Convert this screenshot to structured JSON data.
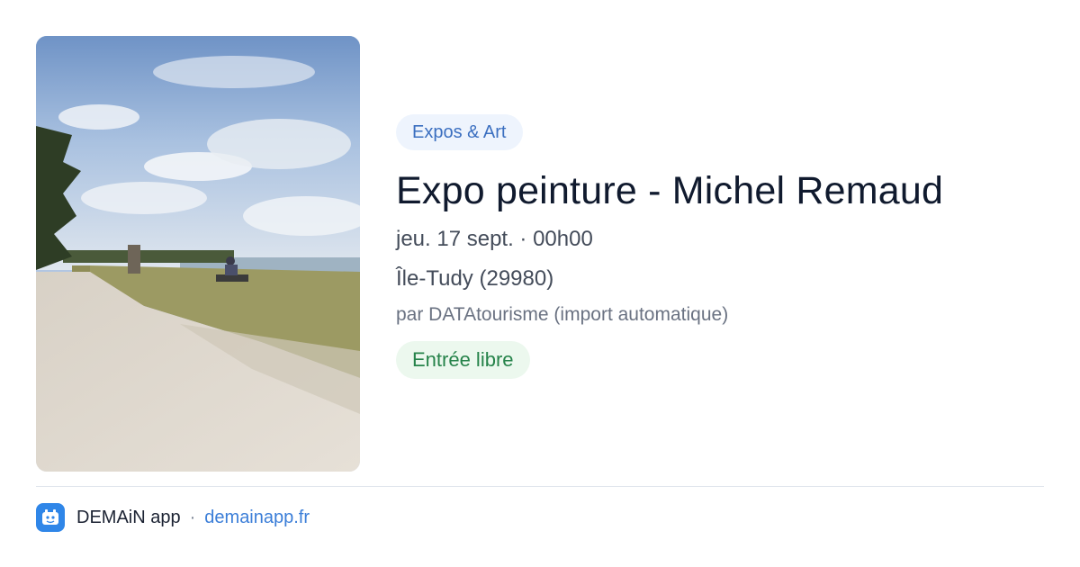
{
  "photo": {
    "icon": "landscape-photo",
    "description_colors": {
      "sky": "#8fb0d8",
      "sand": "#d9d2c8",
      "grass": "#9d9a62"
    }
  },
  "event": {
    "category": "Expos & Art",
    "title": "Expo peinture - Michel Remaud",
    "datetime": "jeu. 17 sept. · 00h00",
    "location": "Île-Tudy (29980)",
    "source": "par DATAtourisme (import automatique)",
    "price": "Entrée libre"
  },
  "footer": {
    "app_name": "DEMAiN app",
    "separator": "·",
    "url": "demainapp.fr",
    "icon": "app-logo-icon"
  },
  "colors": {
    "category_bg": "#eef4fd",
    "category_text": "#3b6fc0",
    "price_bg": "#ecf8ee",
    "price_text": "#26834a",
    "link": "#3b7ed8",
    "app_icon": "#2f86e8"
  }
}
